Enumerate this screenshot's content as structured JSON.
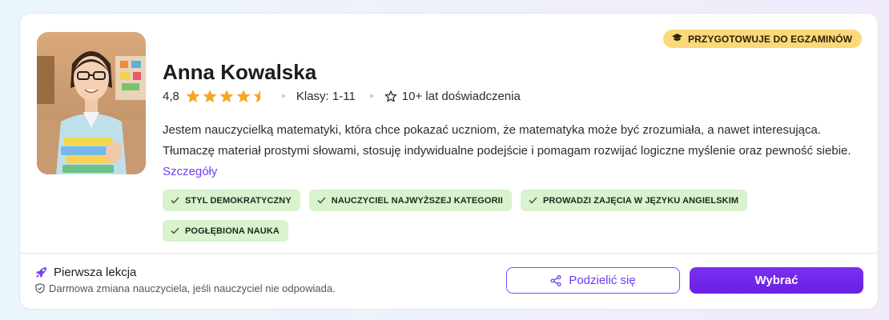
{
  "badge": {
    "label": "PRZYGOTOWUJE DO EGZAMINÓW",
    "icon": "graduation-cap-icon",
    "color": "#fbd97a"
  },
  "teacher": {
    "name": "Anna Kowalska",
    "rating": "4,8",
    "rating_value": 4.8,
    "stars_max": 5,
    "grades": "Klasy: 1-11",
    "experience": "10+ lat doświadczenia",
    "experience_icon": "star-outline-icon",
    "description": "Jestem nauczycielką matematyki, która chce pokazać uczniom, że matematyka może być zrozumiała, a nawet interesująca. Tłumaczę materiał prostymi słowami, stosuję indywidualne podejście i pomagam rozwijać logiczne myślenie oraz pewność siebie.",
    "details_link": "Szczegóły"
  },
  "tags": [
    "STYL DEMOKRATYCZNY",
    "NAUCZYCIEL NAJWYŻSZEJ KATEGORII",
    "PROWADZI ZAJĘCIA W JĘZYKU ANGIELSKIM",
    "POGŁĘBIONA NAUKA"
  ],
  "footer": {
    "first_lesson": "Pierwsza lekcja",
    "first_lesson_icon": "rocket-icon",
    "guarantee": "Darmowa zmiana nauczyciela, jeśli nauczyciel nie odpowiada.",
    "guarantee_icon": "shield-icon",
    "share_button": "Podzielić się",
    "share_icon": "share-icon",
    "choose_button": "Wybrać"
  },
  "colors": {
    "accent": "#6c3cf0",
    "star": "#f5a623",
    "tag_bg": "#d8f3ce",
    "primary_button": "#6a1fe3"
  }
}
